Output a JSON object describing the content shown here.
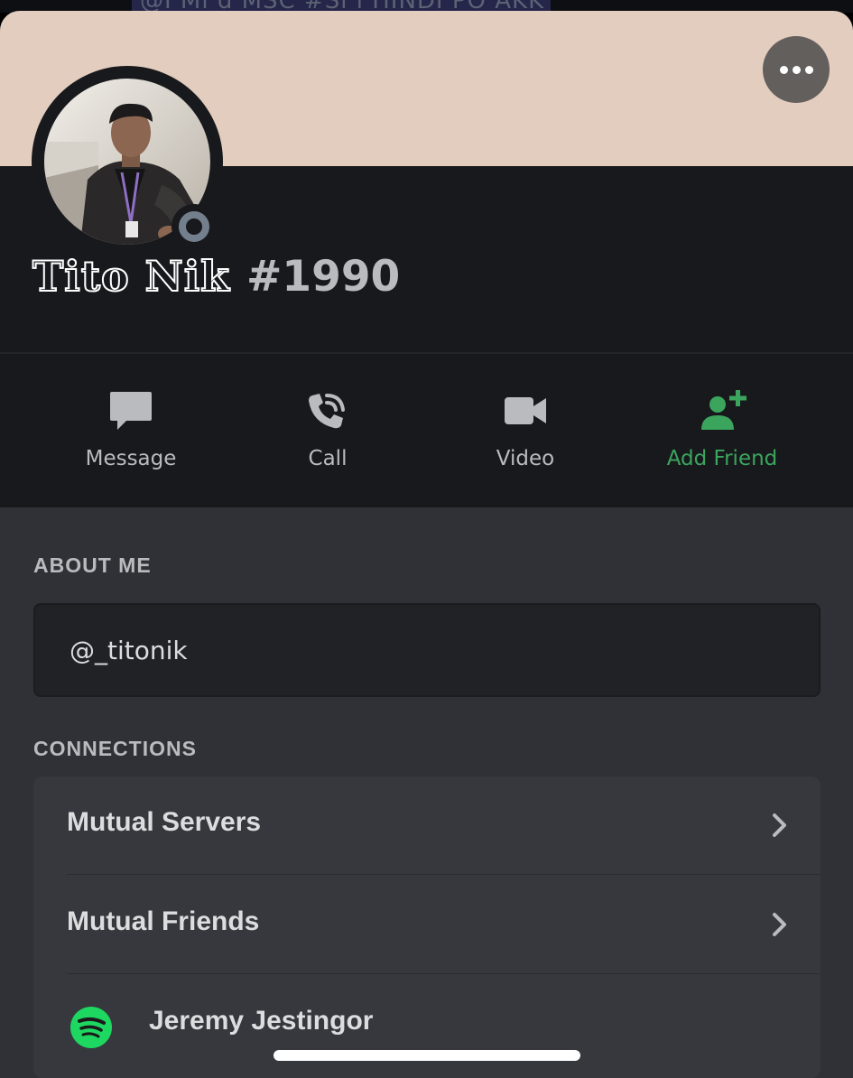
{
  "background_peek": {
    "text": "@I Mi    d MSC   #Sl   l    HINDI PO AKK"
  },
  "profile": {
    "display_name": "Tito Nik",
    "discriminator": "#1990",
    "banner_color": "#e2cdbf",
    "status": "offline",
    "status_color": "#747f8d"
  },
  "actions": [
    {
      "label": "Message",
      "icon": "message-icon"
    },
    {
      "label": "Call",
      "icon": "phone-call-icon"
    },
    {
      "label": "Video",
      "icon": "video-camera-icon"
    },
    {
      "label": "Add Friend",
      "icon": "add-friend-icon",
      "color": "#3ba55d"
    }
  ],
  "about": {
    "heading": "ABOUT ME",
    "text": "@_titonik"
  },
  "connections": {
    "heading": "CONNECTIONS",
    "rows": [
      {
        "label": "Mutual Servers",
        "icon": "chevron-right-icon"
      },
      {
        "label": "Mutual Friends",
        "icon": "chevron-right-icon"
      },
      {
        "label": "Jeremy Jestingor",
        "icon": "spotify-icon",
        "icon_color": "#1ed760"
      }
    ]
  }
}
